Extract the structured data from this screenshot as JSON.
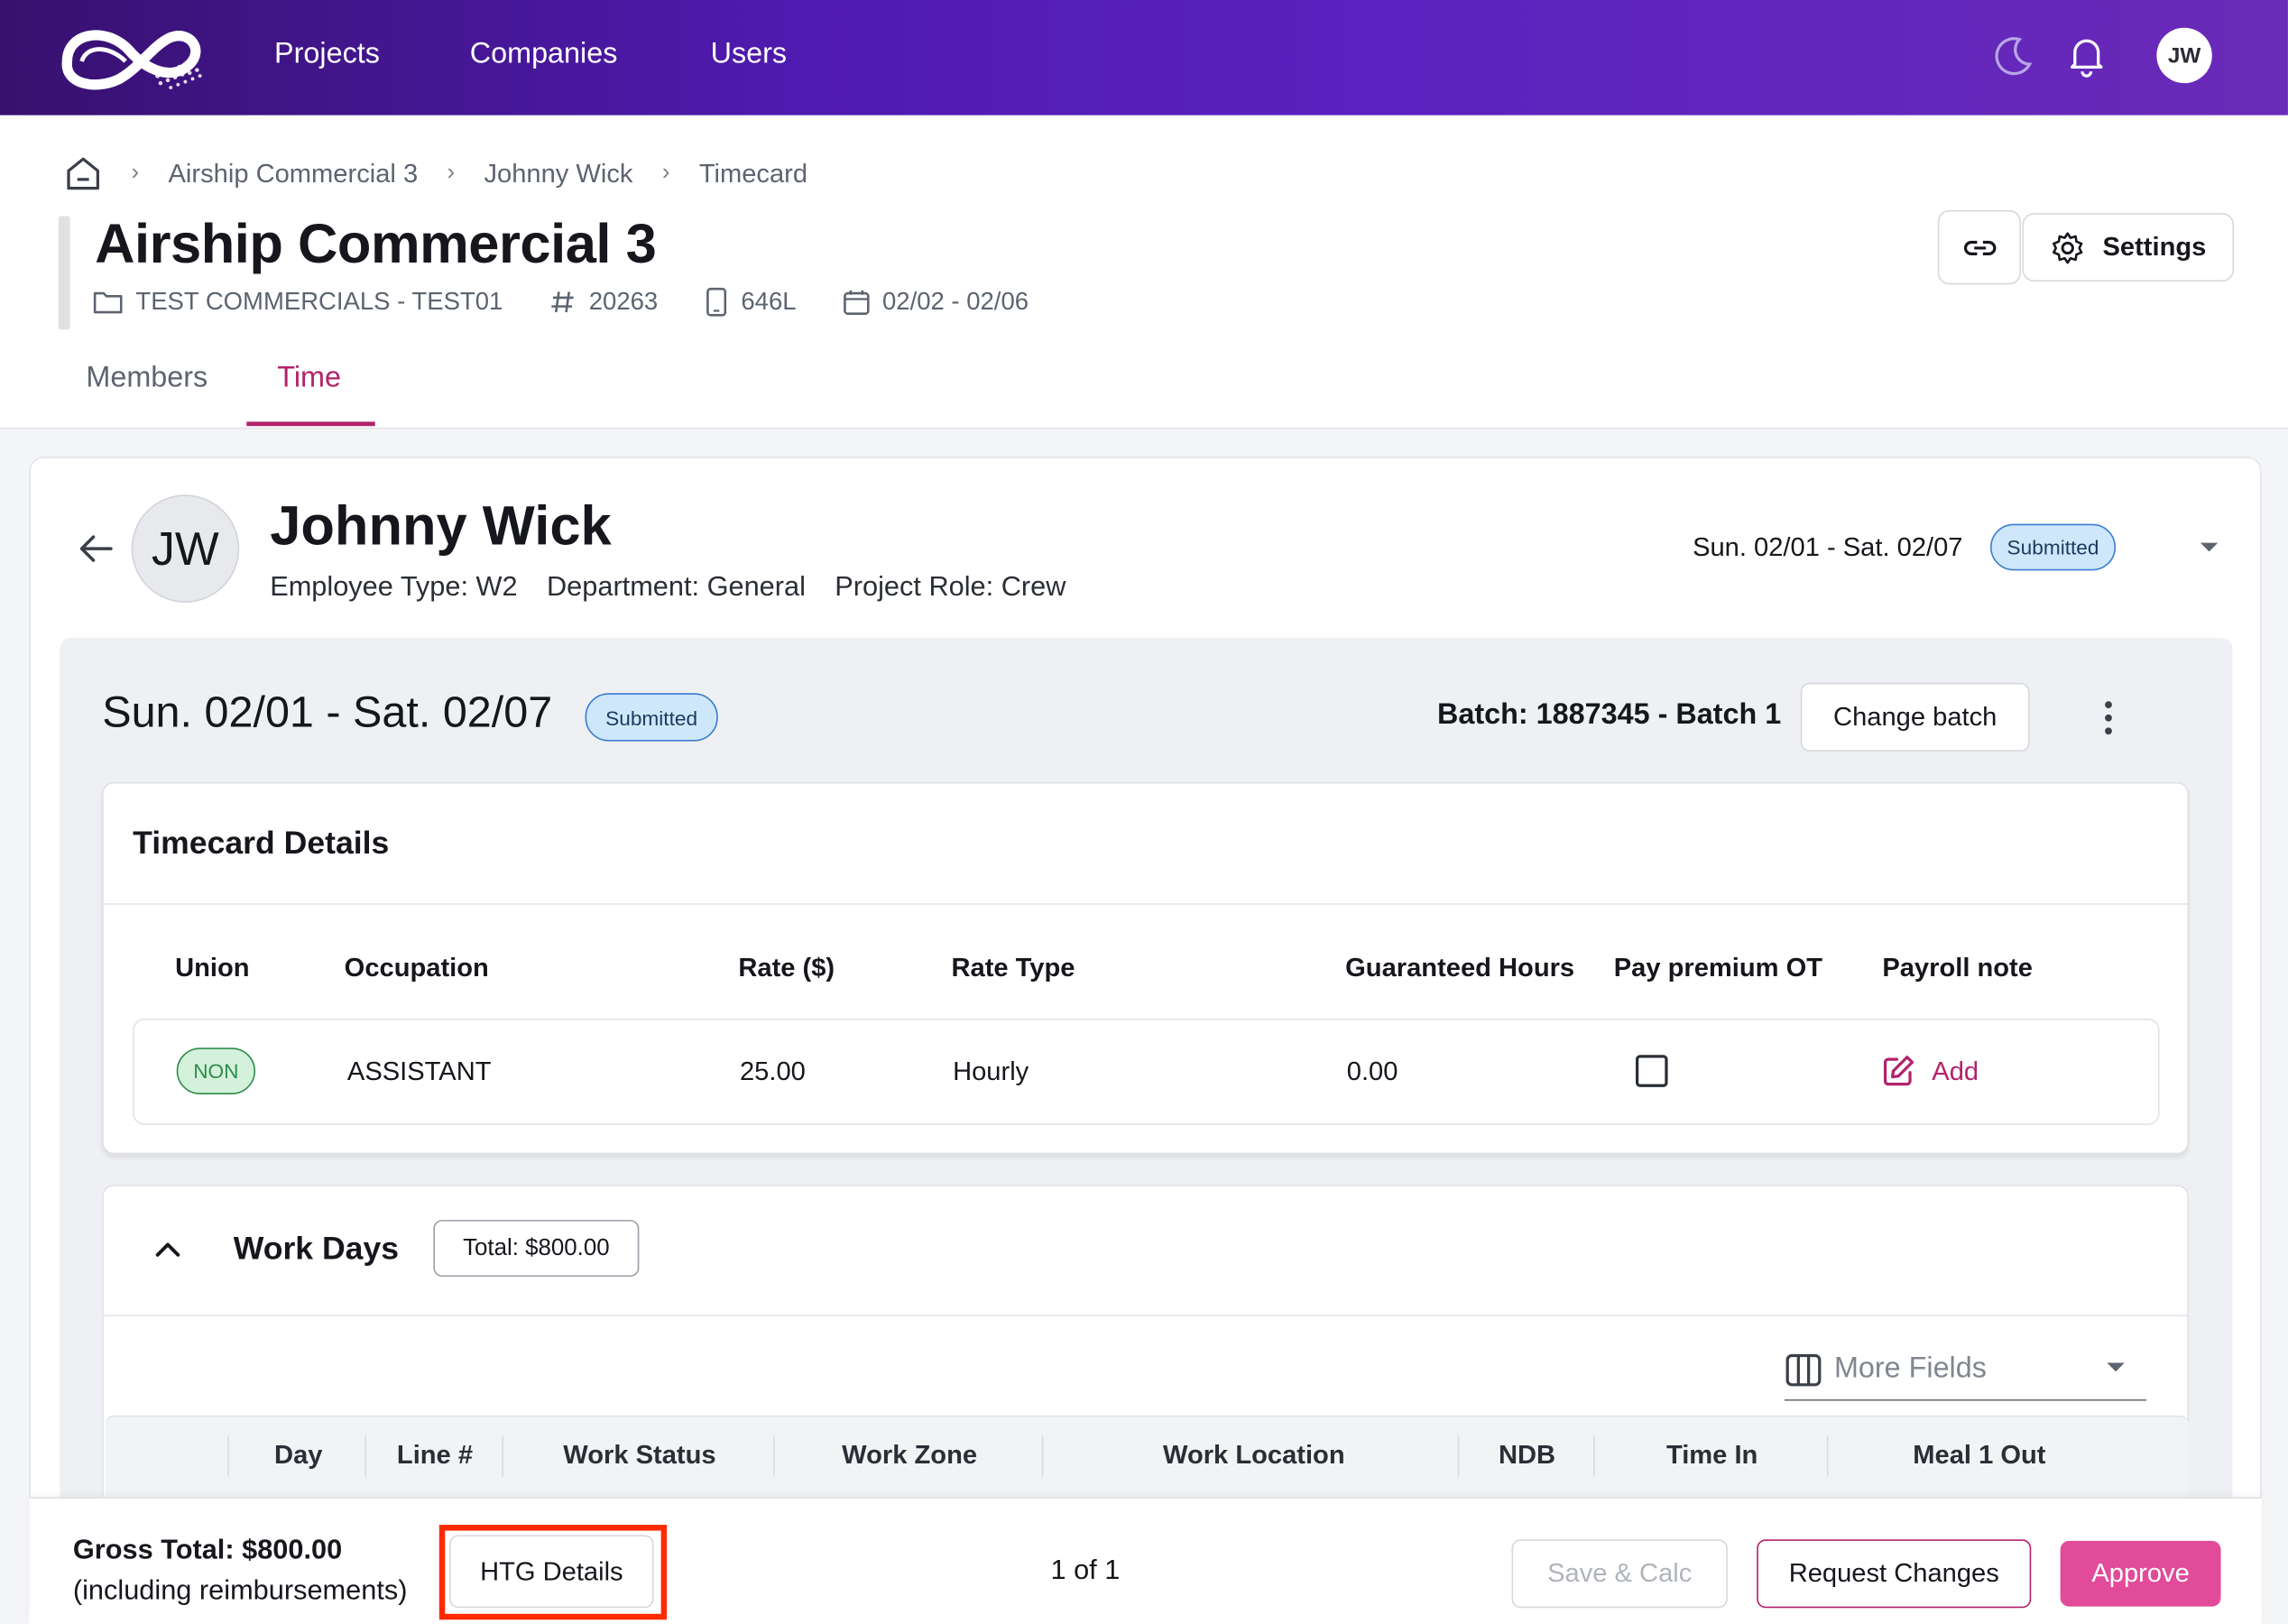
{
  "nav": {
    "links": [
      "Projects",
      "Companies",
      "Users"
    ],
    "user_initials": "JW",
    "icons": [
      "moon-icon",
      "bell-icon"
    ]
  },
  "breadcrumb": {
    "items": [
      "Airship Commercial 3",
      "Johnny Wick",
      "Timecard"
    ]
  },
  "project": {
    "title": "Airship Commercial 3",
    "company": "TEST COMMERCIALS - TEST01",
    "number": "20263",
    "code": "646L",
    "dates": "02/02 - 02/06"
  },
  "header_buttons": {
    "settings": "Settings"
  },
  "tabs": [
    "Members",
    "Time"
  ],
  "employee": {
    "initials": "JW",
    "name": "Johnny Wick",
    "employee_type": "Employee Type: W2",
    "department": "Department: General",
    "project_role": "Project Role: Crew",
    "period": "Sun. 02/01 - Sat. 02/07",
    "status": "Submitted"
  },
  "timecard": {
    "period": "Sun. 02/01 - Sat. 02/07",
    "status": "Submitted",
    "batch": "Batch: 1887345 - Batch 1",
    "change_batch": "Change batch"
  },
  "timecard_details": {
    "title": "Timecard Details",
    "columns": [
      "Union",
      "Occupation",
      "Rate ($)",
      "Rate Type",
      "Guaranteed Hours",
      "Pay premium OT",
      "Payroll note"
    ],
    "row": {
      "union": "NON",
      "occupation": "ASSISTANT",
      "rate": "25.00",
      "rate_type": "Hourly",
      "guaranteed_hours": "0.00",
      "pay_premium_ot": false,
      "payroll_note_action": "Add"
    }
  },
  "work_days": {
    "title": "Work Days",
    "total": "Total: $800.00",
    "more_fields": "More Fields",
    "columns": [
      "Day",
      "Line #",
      "Work Status",
      "Work Zone",
      "Work Location",
      "NDB",
      "Time In",
      "Meal 1 Out"
    ]
  },
  "footer": {
    "gross_total": "Gross Total: $800.00",
    "gross_sub": "(including reimbursements)",
    "htg_details": "HTG Details",
    "pager": "1 of 1",
    "save_calc": "Save & Calc",
    "request_changes": "Request Changes",
    "approve": "Approve"
  },
  "colors": {
    "accent": "#b3226b",
    "approve": "#e14b9a",
    "nav_gradient_start": "#38116f",
    "nav_gradient_end": "#6a2ab8",
    "highlight": "#ff2a00"
  }
}
